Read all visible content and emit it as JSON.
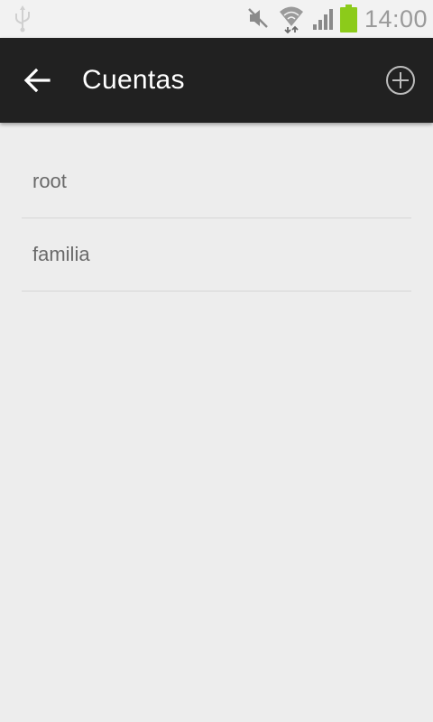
{
  "status_bar": {
    "time": "14:00",
    "icons": [
      "usb-icon",
      "mute-icon",
      "wifi-icon",
      "signal-icon",
      "battery-icon"
    ],
    "battery_color": "#8ccb1a"
  },
  "app_bar": {
    "title": "Cuentas",
    "back_icon": "arrow-left-icon",
    "action_icon": "add-circle-icon",
    "background": "#212121"
  },
  "accounts": [
    {
      "label": "root"
    },
    {
      "label": "familia"
    }
  ]
}
